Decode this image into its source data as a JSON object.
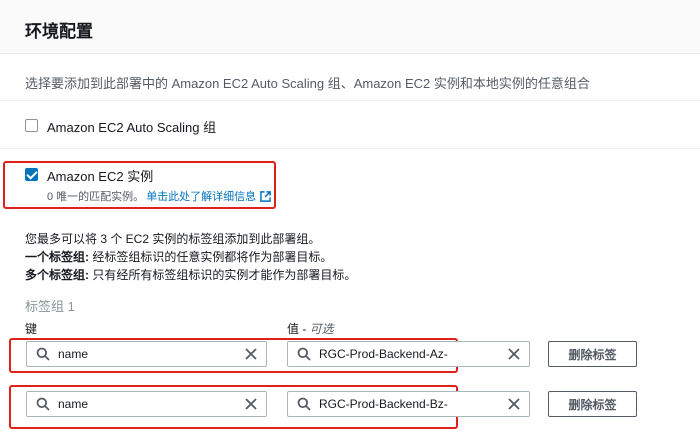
{
  "panel": {
    "title": "环境配置",
    "description": "选择要添加到此部署中的 Amazon EC2 Auto Scaling 组、Amazon EC2 实例和本地实例的任意组合"
  },
  "options": {
    "asg": {
      "label": "Amazon EC2 Auto Scaling 组",
      "checked": false
    },
    "ec2": {
      "label": "Amazon EC2 实例",
      "checked": true,
      "match_text": "0 唯一的匹配实例。",
      "link_text": "单击此处了解详细信息"
    }
  },
  "info": {
    "line1": "您最多可以将 3 个 EC2 实例的标签组添加到此部署组。",
    "line2_bold": "一个标签组:",
    "line2_rest": " 经标签组标识的任意实例都将作为部署目标。",
    "line3_bold": "多个标签组:",
    "line3_rest": " 只有经所有标签组标识的实例才能作为部署目标。"
  },
  "tag_group": {
    "label": "标签组 1",
    "key_label": "键",
    "value_label": "值 - ",
    "value_optional": "可选",
    "rows": [
      {
        "key": "name",
        "value": "RGC-Prod-Backend-Az-",
        "remove_label": "删除标签"
      },
      {
        "key": "name",
        "value": "RGC-Prod-Backend-Bz-",
        "remove_label": "删除标签"
      }
    ]
  },
  "colors": {
    "accent": "#0073bb",
    "highlight": "#e0201a"
  }
}
